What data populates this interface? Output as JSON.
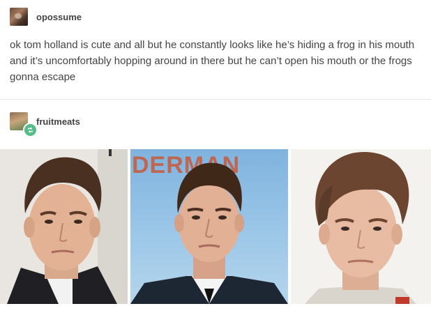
{
  "original_post": {
    "username": "opossume",
    "text": "ok tom holland is cute and all but he constantly looks like he’s hiding a frog in his mouth and it’s uncomfortably hopping around in there but he can’t open his mouth or the frogs gonna escape"
  },
  "reblog": {
    "username": "fruitmeats",
    "badge_icon": "reblog-icon"
  },
  "photos": {
    "count": 3,
    "photo2_background_text": "DERMAN",
    "photo1_background_text": "irk"
  },
  "colors": {
    "text": "#444444",
    "reblog_badge": "#56bc8a",
    "divider": "#e5e5e5"
  }
}
